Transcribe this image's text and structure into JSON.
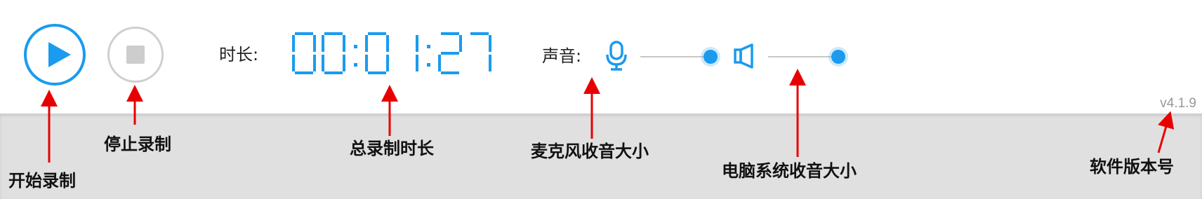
{
  "controls": {
    "play_icon": "play-icon",
    "stop_icon": "stop-icon"
  },
  "duration": {
    "label": "时长:",
    "time": "00:01:27"
  },
  "sound": {
    "label": "声音:",
    "mic_icon": "microphone-icon",
    "mic_level": 1.0,
    "speaker_icon": "speaker-icon",
    "system_level": 1.0
  },
  "version": "v4.1.9",
  "annotations": {
    "start_record": "开始录制",
    "stop_record": "停止录制",
    "total_duration": "总录制时长",
    "mic_volume": "麦克风收音大小",
    "system_volume": "电脑系统收音大小",
    "version_number": "软件版本号"
  },
  "colors": {
    "accent": "#1a9bef",
    "disabled": "#cdcdcd",
    "arrow": "#e80000",
    "annotation_bg": "#e0e0e0"
  }
}
